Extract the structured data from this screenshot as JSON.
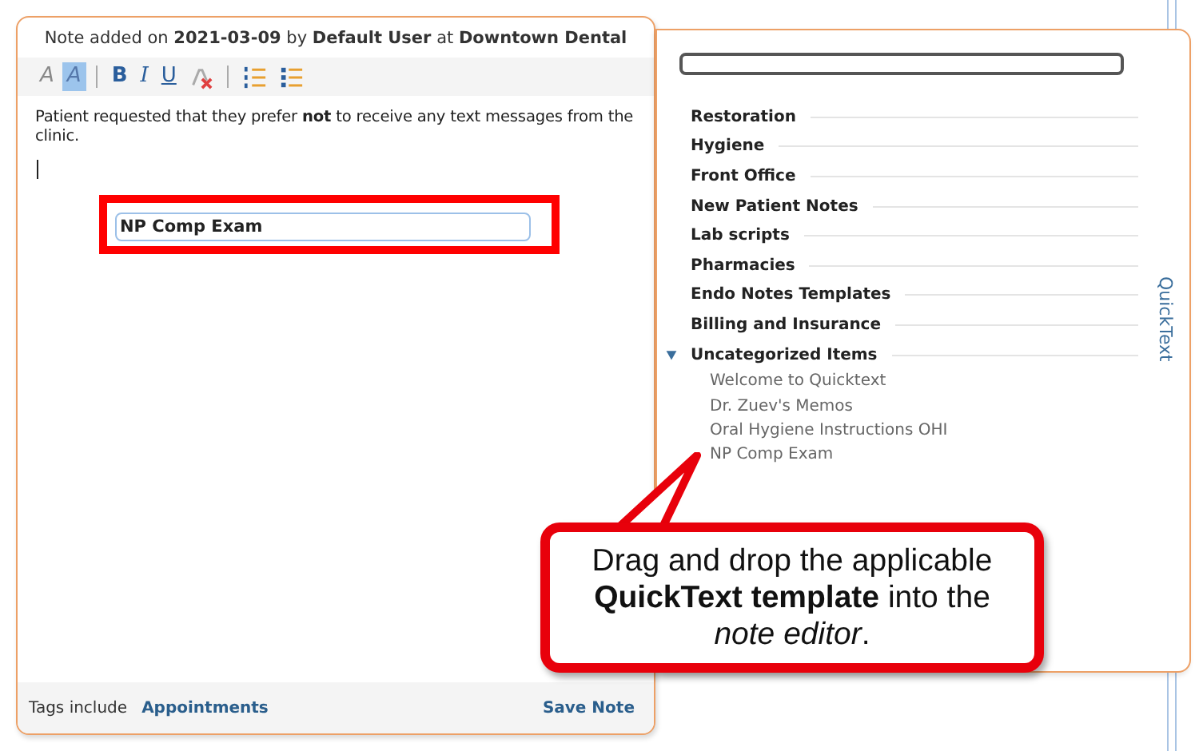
{
  "note": {
    "header": "Note added on **2021-03-09** by **Default User** at **Downtown Dental**",
    "toolbar": [
      {
        "kind": "font",
        "label": "A",
        "active": false
      },
      {
        "kind": "font",
        "label": "A",
        "active": true
      },
      {
        "kind": "bold",
        "label": "B",
        "active": false
      },
      {
        "kind": "italic",
        "label": "I",
        "active": false
      },
      {
        "kind": "underline",
        "label": "U",
        "active": false
      },
      {
        "kind": "clear",
        "active": false
      },
      {
        "kind": "numbered-list",
        "active": false
      },
      {
        "kind": "bullet-list",
        "active": false
      }
    ],
    "body": "Patient requested that they prefer **not** to receive any text messages from the clinic.",
    "template_field": {
      "value": "NP Comp Exam"
    },
    "tags_label": "Tags include",
    "tags_link": "Appointments",
    "save": "Save Note"
  },
  "quicktext": {
    "title": "QuickText",
    "categories": [
      {
        "label": "Restoration",
        "expanded": false
      },
      {
        "label": "Hygiene",
        "expanded": false
      },
      {
        "label": "Front Office",
        "expanded": false
      },
      {
        "label": "New Patient Notes",
        "expanded": false
      },
      {
        "label": "Lab scripts",
        "expanded": false
      },
      {
        "label": "Pharmacies",
        "expanded": false
      },
      {
        "label": "Endo Notes Templates",
        "expanded": false
      },
      {
        "label": "Billing and Insurance",
        "expanded": false
      },
      {
        "label": "Uncategorized Items",
        "expanded": true,
        "children": [
          {
            "label": "Welcome to Quicktext"
          },
          {
            "label": "Dr. Zuev's Memos"
          },
          {
            "label": "Oral Hygiene Instructions OHI"
          },
          {
            "label": "NP Comp Exam"
          }
        ]
      }
    ]
  },
  "callout": {
    "text": "Drag and drop the applicable **QuickText template** into the *note editor*."
  }
}
